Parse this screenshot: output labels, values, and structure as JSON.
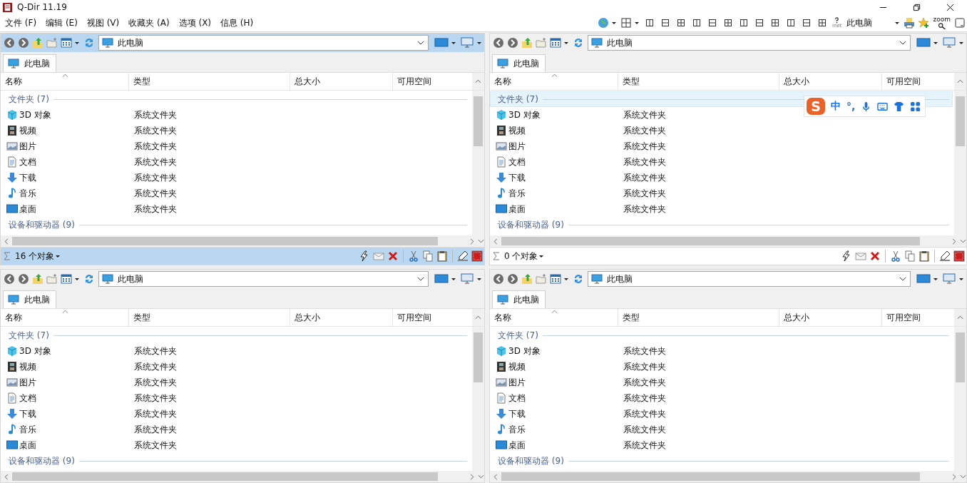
{
  "window": {
    "title": "Q-Dir 11.19"
  },
  "menu": [
    "文件 (F)",
    "编辑 (E)",
    "视图 (V)",
    "收藏夹 (A)",
    "选项 (X)",
    "信息 (H)"
  ],
  "toolbar": {
    "help_label": "inet",
    "location": "此电脑",
    "zoom_label": "zoom"
  },
  "ime": {
    "logo": "S",
    "mode": "中",
    "punct": "°,"
  },
  "panes": [
    {
      "selected": true,
      "address": "此电脑",
      "tab": "此电脑",
      "columns": [
        "名称",
        "类型",
        "总大小",
        "可用空间"
      ],
      "groups": [
        {
          "label": "文件夹 (7)",
          "selected": false,
          "items": [
            {
              "name": "3D 对象",
              "type": "系统文件夹",
              "kind": "cube"
            },
            {
              "name": "视频",
              "type": "系统文件夹",
              "kind": "film"
            },
            {
              "name": "图片",
              "type": "系统文件夹",
              "kind": "picture"
            },
            {
              "name": "文档",
              "type": "系统文件夹",
              "kind": "document"
            },
            {
              "name": "下载",
              "type": "系统文件夹",
              "kind": "download"
            },
            {
              "name": "音乐",
              "type": "系统文件夹",
              "kind": "music"
            },
            {
              "name": "桌面",
              "type": "系统文件夹",
              "kind": "desktop"
            }
          ]
        },
        {
          "label": "设备和驱动器 (9)",
          "selected": false
        }
      ],
      "status": "16 个对象"
    },
    {
      "selected": false,
      "address": "此电脑",
      "tab": "此电脑",
      "columns": [
        "名称",
        "类型",
        "总大小",
        "可用空间"
      ],
      "groups": [
        {
          "label": "文件夹 (7)",
          "selected": true,
          "items": [
            {
              "name": "3D 对象",
              "type": "系统文件夹",
              "kind": "cube"
            },
            {
              "name": "视频",
              "type": "系统文件夹",
              "kind": "film"
            },
            {
              "name": "图片",
              "type": "系统文件夹",
              "kind": "picture"
            },
            {
              "name": "文档",
              "type": "系统文件夹",
              "kind": "document"
            },
            {
              "name": "下载",
              "type": "系统文件夹",
              "kind": "download"
            },
            {
              "name": "音乐",
              "type": "系统文件夹",
              "kind": "music"
            },
            {
              "name": "桌面",
              "type": "系统文件夹",
              "kind": "desktop"
            }
          ]
        },
        {
          "label": "设备和驱动器 (9)",
          "selected": false
        }
      ],
      "status": "0 个对象"
    },
    {
      "selected": false,
      "address": "此电脑",
      "tab": "此电脑",
      "columns": [
        "名称",
        "类型",
        "总大小",
        "可用空间"
      ],
      "groups": [
        {
          "label": "文件夹 (7)",
          "selected": false,
          "items": [
            {
              "name": "3D 对象",
              "type": "系统文件夹",
              "kind": "cube"
            },
            {
              "name": "视频",
              "type": "系统文件夹",
              "kind": "film"
            },
            {
              "name": "图片",
              "type": "系统文件夹",
              "kind": "picture"
            },
            {
              "name": "文档",
              "type": "系统文件夹",
              "kind": "document"
            },
            {
              "name": "下载",
              "type": "系统文件夹",
              "kind": "download"
            },
            {
              "name": "音乐",
              "type": "系统文件夹",
              "kind": "music"
            },
            {
              "name": "桌面",
              "type": "系统文件夹",
              "kind": "desktop"
            }
          ]
        },
        {
          "label": "设备和驱动器 (9)",
          "selected": false
        }
      ]
    },
    {
      "selected": false,
      "address": "此电脑",
      "tab": "此电脑",
      "columns": [
        "名称",
        "类型",
        "总大小",
        "可用空间"
      ],
      "groups": [
        {
          "label": "文件夹 (7)",
          "selected": false,
          "items": [
            {
              "name": "3D 对象",
              "type": "系统文件夹",
              "kind": "cube"
            },
            {
              "name": "视频",
              "type": "系统文件夹",
              "kind": "film"
            },
            {
              "name": "图片",
              "type": "系统文件夹",
              "kind": "picture"
            },
            {
              "name": "文档",
              "type": "系统文件夹",
              "kind": "document"
            },
            {
              "name": "下载",
              "type": "系统文件夹",
              "kind": "download"
            },
            {
              "name": "音乐",
              "type": "系统文件夹",
              "kind": "music"
            },
            {
              "name": "桌面",
              "type": "系统文件夹",
              "kind": "desktop"
            }
          ]
        },
        {
          "label": "设备和驱动器 (9)",
          "selected": false
        }
      ]
    }
  ]
}
